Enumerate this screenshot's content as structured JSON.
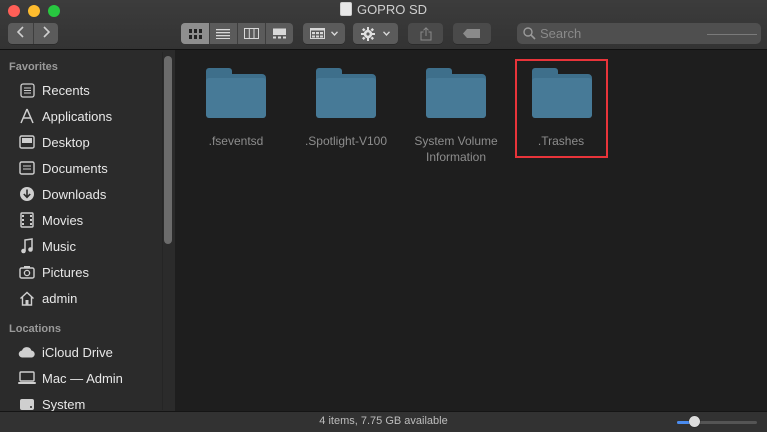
{
  "window": {
    "title": "GOPRO SD"
  },
  "toolbar": {
    "back_icon": "chevron-left-icon",
    "forward_icon": "chevron-right-icon",
    "views": [
      "icon-view",
      "list-view",
      "column-view",
      "gallery-view"
    ],
    "active_view": "icon-view",
    "search": {
      "placeholder": "Search"
    }
  },
  "sidebar": {
    "favorites_heading": "Favorites",
    "favorites": [
      {
        "label": "Recents",
        "icon": "recents-icon"
      },
      {
        "label": "Applications",
        "icon": "applications-icon"
      },
      {
        "label": "Desktop",
        "icon": "desktop-icon"
      },
      {
        "label": "Documents",
        "icon": "documents-icon"
      },
      {
        "label": "Downloads",
        "icon": "downloads-icon"
      },
      {
        "label": "Movies",
        "icon": "movies-icon"
      },
      {
        "label": "Music",
        "icon": "music-icon"
      },
      {
        "label": "Pictures",
        "icon": "pictures-icon"
      },
      {
        "label": "admin",
        "icon": "home-icon"
      }
    ],
    "locations_heading": "Locations",
    "locations": [
      {
        "label": "iCloud Drive",
        "icon": "cloud-icon"
      },
      {
        "label": "Mac — Admin",
        "icon": "computer-icon"
      },
      {
        "label": "System",
        "icon": "disk-icon"
      }
    ]
  },
  "files": [
    {
      "name": ".fseventsd",
      "line2": ""
    },
    {
      "name": ".Spotlight-V100",
      "line2": ""
    },
    {
      "name": "System Volume",
      "line2": "Information"
    },
    {
      "name": ".Trashes",
      "line2": ""
    }
  ],
  "colors": {
    "folder": "#3e6f8b",
    "highlight": "#e8343a",
    "accent": "#4a8cf0"
  },
  "status": {
    "text": "4 items, 7.75 GB available",
    "zoom_fraction": 0.22
  }
}
